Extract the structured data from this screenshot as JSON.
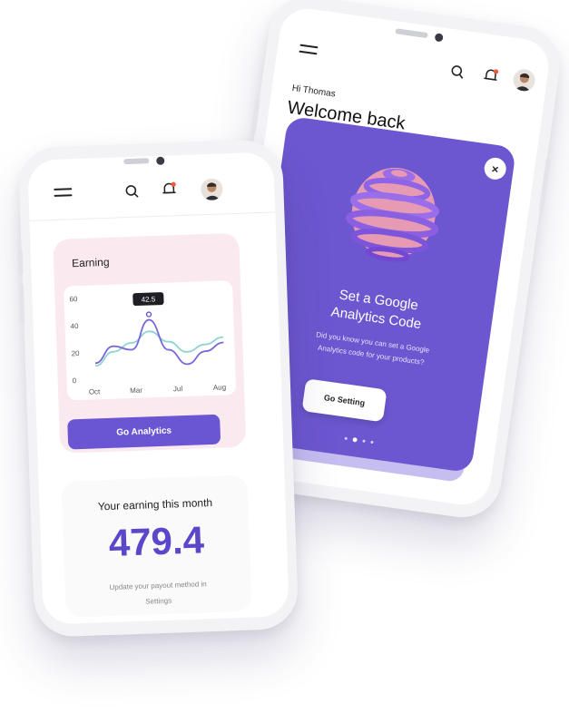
{
  "front_phone": {
    "earning_title": "Earning",
    "chart_data": {
      "type": "line",
      "categories": [
        "Oct",
        "Mar",
        "Jul",
        "Aug"
      ],
      "y_ticks": [
        "60",
        "40",
        "20",
        "0"
      ],
      "ylim": [
        0,
        60
      ],
      "tooltip_value": "42.5",
      "series": [
        {
          "values": [
            12,
            24,
            21,
            42.5,
            20,
            9,
            18,
            24
          ],
          "color": "#7a68d8"
        },
        {
          "values": [
            10,
            20,
            26,
            34,
            26,
            18,
            23,
            28
          ],
          "color": "#8fd3d2"
        }
      ]
    },
    "go_analytics_label": "Go Analytics",
    "month_label": "Your earning this month",
    "amount": "479.4",
    "update_text": "Update your payout method in",
    "settings_text": "Settings"
  },
  "back_phone": {
    "greeting": "Hi Thomas",
    "welcome": "Welcome back",
    "promo_title_1": "Set a Google",
    "promo_title_2": "Analytics Code",
    "promo_body_1": "Did you know you can set a Google",
    "promo_body_2": "Analytics code for your products?",
    "close_glyph": "×",
    "go_setting_label": "Go Setting",
    "page_dots": 4,
    "active_dot": 1
  },
  "colors": {
    "accent": "#6a55d2",
    "promo_bg": "#6c57d0",
    "earning_card": "#fbe9f0",
    "line_purple": "#7a68d8",
    "line_teal": "#8fd3d2"
  },
  "icons": [
    "menu-icon",
    "search-icon",
    "bell-icon",
    "avatar",
    "close-icon"
  ]
}
